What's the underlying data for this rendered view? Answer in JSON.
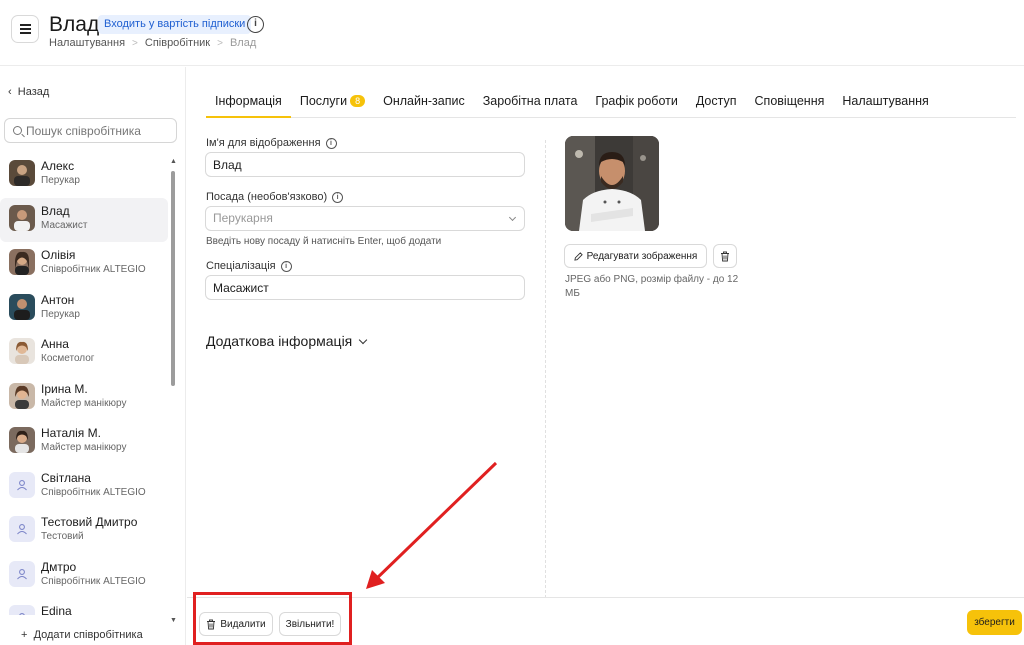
{
  "header": {
    "title": "Влад",
    "subscription_badge": "Входить у вартість підписки",
    "breadcrumb": [
      "Налаштування",
      "Співробітник",
      "Влад"
    ]
  },
  "sidebar": {
    "back_label": "Назад",
    "search_placeholder": "Пошук співробітника",
    "add_label": "Додати співробітника",
    "staff": [
      {
        "name": "Алекс",
        "role": "Перукар"
      },
      {
        "name": "Влад",
        "role": "Масажист"
      },
      {
        "name": "Олівія",
        "role": "Співробітник ALTEGIO"
      },
      {
        "name": "Антон",
        "role": "Перукар"
      },
      {
        "name": "Анна",
        "role": "Косметолог"
      },
      {
        "name": "Ірина М.",
        "role": "Майстер манікюру"
      },
      {
        "name": "Наталія М.",
        "role": "Майстер манікюру"
      },
      {
        "name": "Світлана",
        "role": "Співробітник ALTEGIO"
      },
      {
        "name": "Тестовий Дмитро",
        "role": "Тестовий"
      },
      {
        "name": "Дмтро",
        "role": "Співробітник ALTEGIO"
      },
      {
        "name": "Edina",
        "role": ""
      }
    ]
  },
  "tabs": [
    {
      "label": "Інформація"
    },
    {
      "label": "Послуги",
      "badge": "8"
    },
    {
      "label": "Онлайн-запис"
    },
    {
      "label": "Заробітна плата"
    },
    {
      "label": "Графік роботи"
    },
    {
      "label": "Доступ"
    },
    {
      "label": "Сповіщення"
    },
    {
      "label": "Налаштування"
    }
  ],
  "form": {
    "display_name_label": "Ім'я для відображення",
    "display_name_value": "Влад",
    "position_label": "Посада (необов'язково)",
    "position_placeholder": "Перукарня",
    "position_hint": "Введіть нову посаду й натисніть Enter, щоб додати",
    "specialization_label": "Спеціалізація",
    "specialization_value": "Масажист",
    "extra_section": "Додаткова інформація"
  },
  "photo": {
    "edit_label": "Редагувати зображення",
    "file_hint": "JPEG або PNG, розмір файлу - до 12 МБ"
  },
  "footer": {
    "delete_label": "Видалити",
    "dismiss_label": "Звільнити!",
    "save_label": "зберегти"
  },
  "colors": {
    "accent": "#f6c20a",
    "annotation": "#e02020",
    "badge_bg": "#e8f0fe",
    "badge_text": "#1f5fd1"
  }
}
